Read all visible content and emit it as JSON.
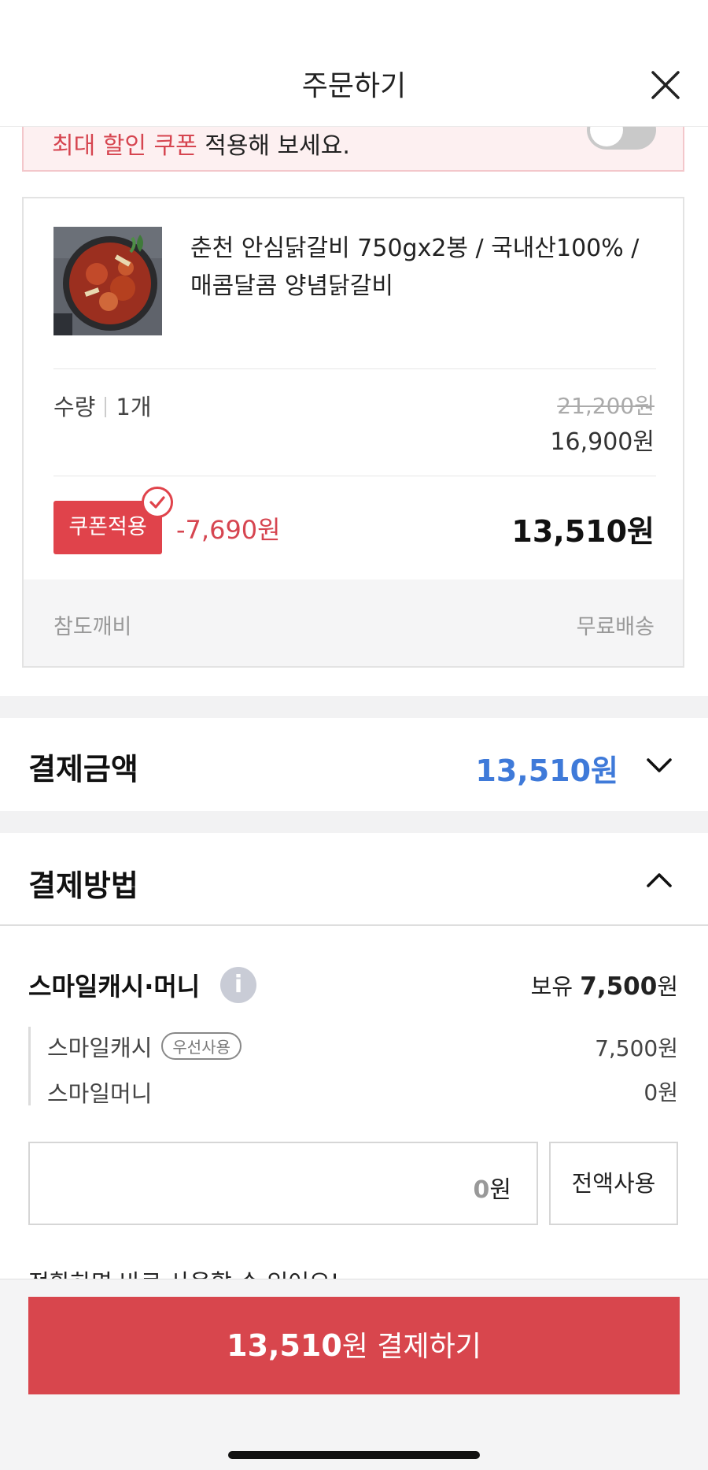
{
  "header": {
    "title": "주문하기",
    "close_icon": "close-icon"
  },
  "coupon_banner": {
    "text_highlight": "최대 할인 쿠폰",
    "text_rest": " 적용해 보세요.",
    "toggle_on": false
  },
  "product": {
    "name": "춘천 안심닭갈비 750gx2봉 / 국내산100% / 매콤달콤 양념닭갈비",
    "quantity_label": "수량",
    "quantity_value": "1개",
    "original_price": "21,200원",
    "sale_price": "16,900원",
    "coupon_label": "쿠폰적용",
    "coupon_discount": "-7,690원",
    "final_price": "13,510원",
    "seller": "참도깨비",
    "shipping": "무료배송"
  },
  "payment_amount": {
    "title": "결제금액",
    "amount": "13,510원",
    "icon": "chevron-down-icon"
  },
  "payment_method": {
    "title": "결제방법",
    "icon": "chevron-up-icon"
  },
  "smile": {
    "title": "스마일캐시·머니",
    "info_icon": "info-icon",
    "owned_label": "보유",
    "owned_amount": "7,500",
    "owned_unit": "원",
    "cash_label": "스마일캐시",
    "cash_badge": "우선사용",
    "cash_value": "7,500원",
    "money_label": "스마일머니",
    "money_value": "0원",
    "input_value": "0",
    "input_unit": "원",
    "use_all_label": "전액사용",
    "partial_text": "전환하면 바로 사용할 수 있어요!"
  },
  "bottom": {
    "pay_amount": "13,510",
    "pay_unit": "원 결제하기"
  },
  "colors": {
    "accent_red": "#d8464d",
    "accent_blue": "#3f7ad9"
  }
}
